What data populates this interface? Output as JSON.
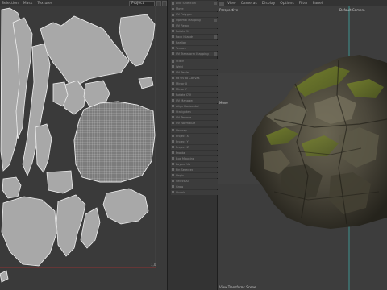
{
  "uv_editor": {
    "menu": [
      "Selection",
      "Mask",
      "Textures"
    ],
    "select_value": "Project",
    "axis_max_label": "1,0",
    "colors": {
      "background": "#3a3a3a",
      "island_fill": "#9a9a9a",
      "island_edge": "#ececec"
    }
  },
  "command_panel": {
    "items": [
      {
        "label": "Live Selection"
      },
      {
        "label": "Move"
      },
      {
        "label": "UV Polygon"
      },
      {
        "label": "Optimal Mapping"
      },
      {
        "label": "UV Relax"
      },
      {
        "label": "Rotate 90"
      },
      {
        "label": "Pack Islands"
      },
      {
        "label": "Realign"
      },
      {
        "label": "Terrace"
      },
      {
        "label": "UV Transform Mapping"
      },
      {
        "label": "Stitch"
      },
      {
        "label": "Weld"
      },
      {
        "label": "UV Peeler"
      },
      {
        "label": "Fit UV to Canvas"
      },
      {
        "label": "Mirror X"
      },
      {
        "label": "Mirror Y"
      },
      {
        "label": "Rotate CW"
      },
      {
        "label": "UV Manager"
      },
      {
        "label": "Align Horizontal"
      },
      {
        "label": "Straighten"
      },
      {
        "label": "UV Terrace"
      },
      {
        "label": "UV Normalize"
      },
      {
        "label": "Unwrap"
      },
      {
        "label": "Project X"
      },
      {
        "label": "Project Y"
      },
      {
        "label": "Project Z"
      },
      {
        "label": "Frontal"
      },
      {
        "label": "Box Mapping"
      },
      {
        "label": "Layout UV"
      },
      {
        "label": "Pin Selected"
      },
      {
        "label": "Unpin"
      },
      {
        "label": "Select All"
      },
      {
        "label": "Grow"
      },
      {
        "label": "Shrink"
      }
    ]
  },
  "viewport": {
    "menu": [
      "View",
      "Cameras",
      "Display",
      "Options",
      "Filter",
      "Panel"
    ],
    "mode_label": "Perspective",
    "camera_label": "Default Camera",
    "move_label": "Move",
    "status_label": "View Transform: Scene",
    "colors": {
      "background": "#3d3d3d",
      "rock_dark": "#2f2c22",
      "rock_mid": "#5a5847",
      "moss": "#6f7a2a"
    }
  }
}
